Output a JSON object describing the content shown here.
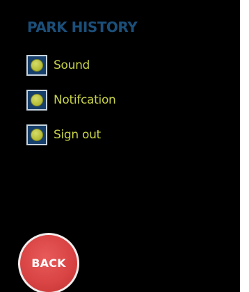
{
  "header": {
    "title": "PARK HISTORY"
  },
  "options": [
    {
      "label": "Sound",
      "icon": "radio-dot-icon"
    },
    {
      "label": "Notifcation",
      "icon": "radio-dot-icon"
    },
    {
      "label": "Sign out",
      "icon": "radio-dot-icon"
    }
  ],
  "footer": {
    "back_label": "BACK"
  },
  "colors": {
    "background": "#000000",
    "title": "#1b4f7a",
    "option_text": "#c8d248",
    "checkbox_fill": "#173f6b",
    "dot": "#b8c03a",
    "back_button": "#d94444"
  }
}
